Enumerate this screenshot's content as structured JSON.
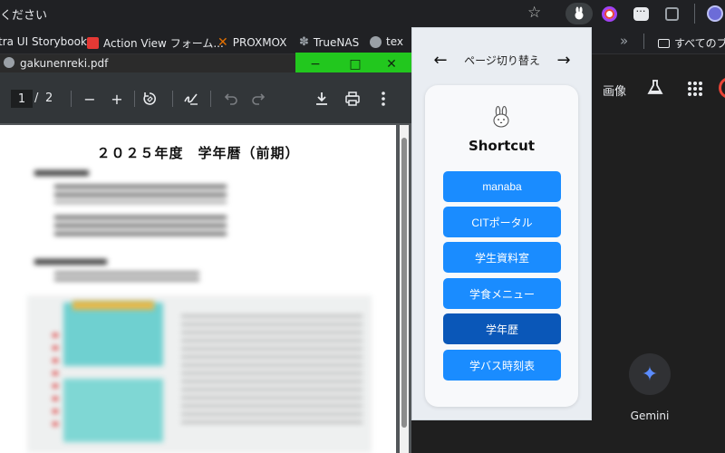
{
  "browser": {
    "omnibox_text": "ください",
    "extensions": [
      "rabbit-extension-icon",
      "ring-extension-icon",
      "chat-extension-icon",
      "puzzle-icon",
      "profile-avatar"
    ]
  },
  "bookmarks": {
    "items": [
      {
        "label": "tra UI Storybook",
        "icon": "storybook-icon"
      },
      {
        "label": "Action View フォーム...",
        "icon": "rails-icon"
      },
      {
        "label": "PROXMOX",
        "icon": "proxmox-icon"
      },
      {
        "label": "TrueNAS",
        "icon": "truenas-icon"
      },
      {
        "label": "tex",
        "icon": "globe-icon"
      }
    ],
    "overflow": "»",
    "all_bookmarks": "すべてのブック"
  },
  "right_page": {
    "images_link": "画像",
    "gemini_label": "Gemini"
  },
  "pdf": {
    "filename": "gakunenreki.pdf",
    "page_current": "1",
    "page_separator": "/",
    "page_total": "2",
    "zoom_out": "−",
    "zoom_in": "+",
    "doc_title": "２０２５年度　学年暦（前期）"
  },
  "popup": {
    "prev": "←",
    "next": "→",
    "switch_label": "ページ切り替え",
    "title": "Shortcut",
    "buttons": [
      {
        "label": "manaba",
        "active": false
      },
      {
        "label": "CITポータル",
        "active": false
      },
      {
        "label": "学生資料室",
        "active": false
      },
      {
        "label": "学食メニュー",
        "active": false
      },
      {
        "label": "学年歴",
        "active": true
      },
      {
        "label": "学バス時刻表",
        "active": false
      }
    ],
    "accent": "#1a8cff",
    "accent_active": "#0a57b8"
  },
  "window_controls": {
    "minimize": "−",
    "maximize": "□",
    "close": "✕",
    "color": "#22c71e"
  }
}
